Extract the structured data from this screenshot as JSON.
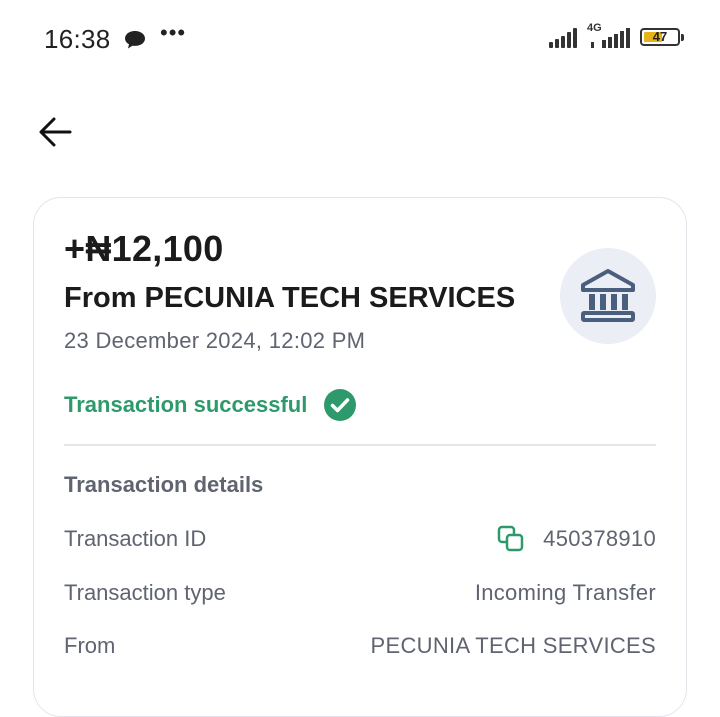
{
  "status_bar": {
    "time": "16:38",
    "network": "4G",
    "battery": "47"
  },
  "transaction": {
    "amount": "+₦12,100",
    "from_title": "From PECUNIA TECH SERVICES",
    "date": "23 December 2024, 12:02 PM",
    "status": "Transaction successful",
    "status_color": "#2e9a6b"
  },
  "details": {
    "title": "Transaction details",
    "rows": [
      {
        "label": "Transaction ID",
        "value": "450378910"
      },
      {
        "label": "Transaction type",
        "value": "Incoming Transfer"
      },
      {
        "label": "From",
        "value": "PECUNIA TECH SERVICES"
      }
    ]
  },
  "icons": {
    "back": "arrow-left-icon",
    "bank": "bank-icon",
    "success": "check-circle-icon",
    "copy": "copy-icon"
  },
  "colors": {
    "bank_icon": "#4a5f7d",
    "copy_icon": "#2e9a6b"
  }
}
